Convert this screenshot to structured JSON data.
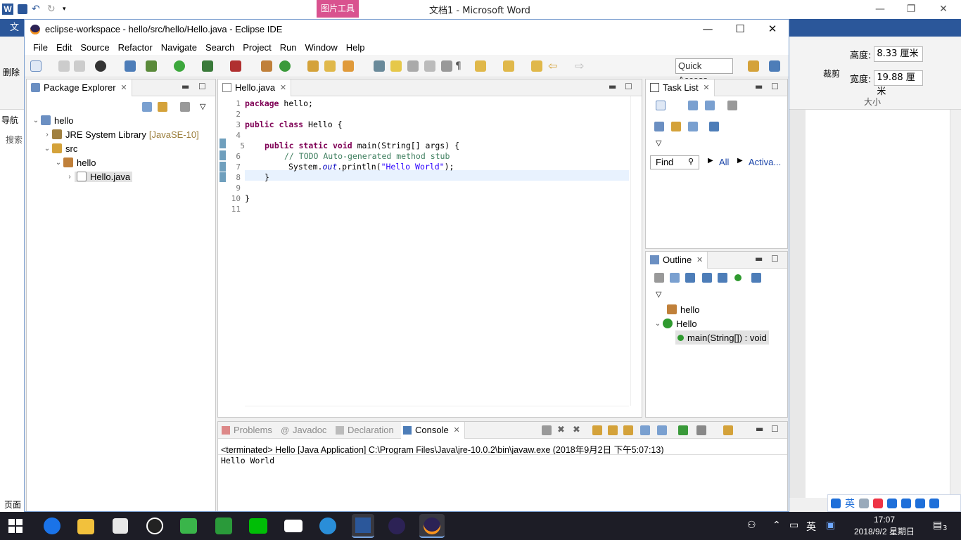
{
  "word": {
    "pic_tools_tab": "图片工具",
    "title": "文档1 - Microsoft Word",
    "file_tab": "文件",
    "logo": "W",
    "delete_label": "删除",
    "nav_label": "导航",
    "search_label": "搜索",
    "page_label": "页面",
    "crop_label": "裁剪",
    "height_label": "高度:",
    "height_value": "8.33 厘米",
    "width_label": "宽度:",
    "width_value": "19.88 厘米",
    "size_group": "大小"
  },
  "eclipse": {
    "title": "eclipse-workspace - hello/src/hello/Hello.java - Eclipse IDE",
    "menu": [
      "File",
      "Edit",
      "Source",
      "Refactor",
      "Navigate",
      "Search",
      "Project",
      "Run",
      "Window",
      "Help"
    ],
    "quick_access": "Quick Access",
    "package_explorer": {
      "tab": "Package Explorer",
      "tree": {
        "project": "hello",
        "jre": "JRE System Library",
        "jre_decor": "[JavaSE-10]",
        "src": "src",
        "package": "hello",
        "file": "Hello.java"
      }
    },
    "editor": {
      "tab": "Hello.java",
      "line_numbers": [
        "1",
        "2",
        "3",
        "4",
        "5",
        "6",
        "7",
        "8",
        "9",
        "10",
        "11"
      ],
      "code": {
        "l1_kw": "package",
        "l1_rest": " hello;",
        "l3_kw1": "public",
        "l3_kw2": "class",
        "l3_rest": " Hello {",
        "l5_kw1": "public",
        "l5_kw2": "static",
        "l5_kw3": "void",
        "l5_rest": " main(String[] args) {",
        "l6_comment": "// TODO Auto-generated method stub",
        "l7_pre": "System.",
        "l7_field": "out",
        "l7_mid": ".println(",
        "l7_str": "\"Hello World\"",
        "l7_end": ");",
        "l8": "}",
        "l10": "}"
      }
    },
    "task_list": {
      "tab": "Task List",
      "find": "Find",
      "all": "All",
      "activate": "Activa..."
    },
    "outline": {
      "tab": "Outline",
      "package": "hello",
      "class": "Hello",
      "method": "main(String[]) : void"
    },
    "bottom_tabs": {
      "problems": "Problems",
      "javadoc": "Javadoc",
      "declaration": "Declaration",
      "console": "Console"
    },
    "console": {
      "info": "<terminated> Hello [Java Application] C:\\Program Files\\Java\\jre-10.0.2\\bin\\javaw.exe (2018年9月2日 下午5:07:13)",
      "output": "Hello World"
    }
  },
  "taskbar": {
    "time": "17:07",
    "date": "2018/9/2 星期日",
    "ime": "英",
    "notification_count": "3"
  },
  "colors": {
    "word_blue": "#2b579a",
    "pic_tools_pink": "#d9528f",
    "keyword": "#7f0055",
    "comment": "#3f7f5f",
    "string": "#2a00ff",
    "taskbar": "#1d1d26"
  }
}
